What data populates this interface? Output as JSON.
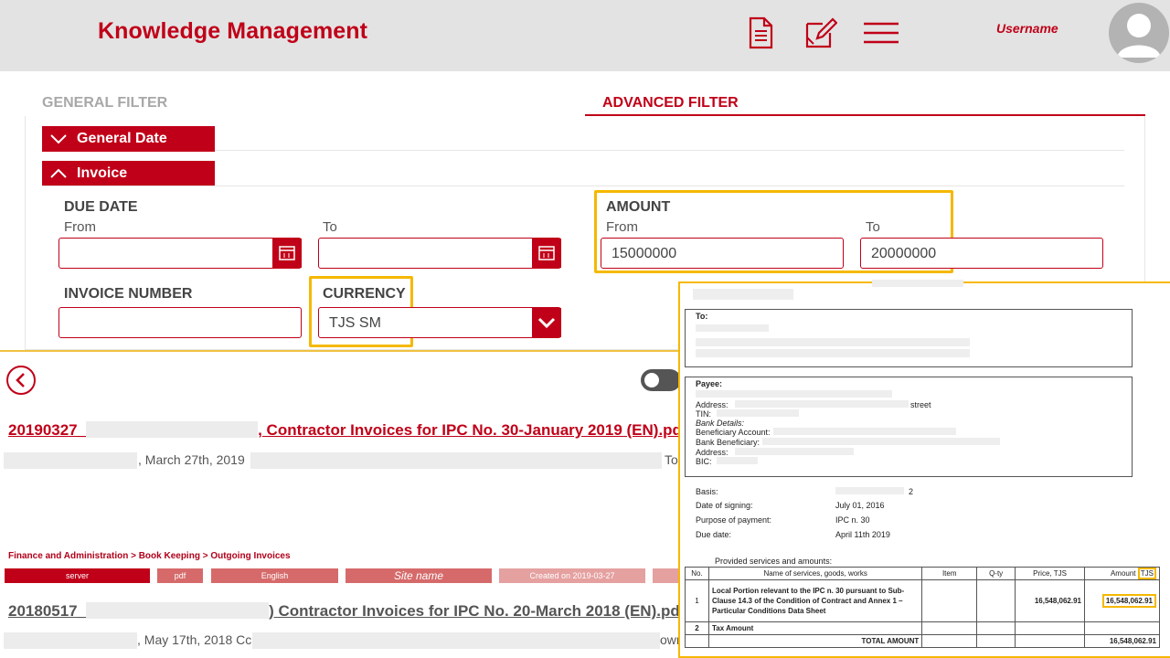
{
  "header": {
    "title": "Knowledge Management",
    "username": "Username",
    "icons": [
      "document-icon",
      "edit-note-icon",
      "menu-icon",
      "avatar-icon"
    ]
  },
  "filters": {
    "tab_general": "GENERAL FILTER",
    "tab_advanced": "ADVANCED FILTER",
    "sections": {
      "general_date": "General Date",
      "invoice": "Invoice"
    },
    "due_date": {
      "label": "DUE DATE",
      "from_label": "From",
      "to_label": "To",
      "from_value": "",
      "to_value": ""
    },
    "amount": {
      "label": "AMOUNT",
      "from_label": "From",
      "to_label": "To",
      "from_value": "15000000",
      "to_value": "20000000"
    },
    "invoice_number": {
      "label": "INVOICE NUMBER",
      "value": ""
    },
    "currency": {
      "label": "CURRENCY",
      "value": "TJS SM"
    }
  },
  "results": [
    {
      "title_prefix": "20190327_",
      "title_sep": ",",
      "title_suffix": " Contractor Invoices for IPC No. 30-January 2019 (EN).pdf",
      "meta_date": ", March 27th, 2019",
      "meta_tail": "To",
      "breadcrumb": "Finance and Administration > Book Keeping > Outgoing Invoices",
      "tags": [
        "server",
        "pdf",
        "English",
        "Site name",
        "Created on 2019-03-27"
      ]
    },
    {
      "title_prefix": "20180517_",
      "title_suffix": ") Contractor Invoices for IPC No. 20-March 2018 (EN).pdf",
      "meta_date": ", May 17th, 2018 Cc",
      "meta_tail": "own"
    }
  ],
  "invoice_doc": {
    "to_label": "To:",
    "payee_label": "Payee:",
    "address_label": "Address:",
    "address_street": "street",
    "tin_label": "TIN:",
    "bank_details_label": "Bank Details:",
    "beneficiary_account_label": "Beneficiary Account:",
    "bank_beneficiary_label": "Bank Beneficiary:",
    "address2_label": "Address:",
    "bic_label": "BIC:",
    "basis_label": "Basis:",
    "basis_value": "2",
    "signing_label": "Date of signing:",
    "signing_value": "July 01, 2016",
    "purpose_label": "Purpose of payment:",
    "purpose_value": "IPC n. 30",
    "due_label": "Due date:",
    "due_value": "April 11th 2019",
    "provided_label": "Provided services and amounts:",
    "table_headers": [
      "No.",
      "Name of services, goods, works",
      "Item",
      "Q-ty",
      "Price, TJS",
      "Amount",
      "TJS"
    ],
    "rows": [
      {
        "no": "1",
        "name": "Local Portion relevant to the IPC n. 30 pursuant to Sub-Clause 14.3 of the Condition of Contract and Annex 1 – Particular Conditions Data Sheet",
        "price": "16,548,062.91",
        "amount": "16,548,062.91"
      },
      {
        "no": "2",
        "name": "Tax Amount"
      }
    ],
    "total_label": "TOTAL AMOUNT",
    "total_value": "16,548,062.91"
  },
  "colors": {
    "brand_red": "#c00018",
    "highlight": "#f5b800"
  }
}
